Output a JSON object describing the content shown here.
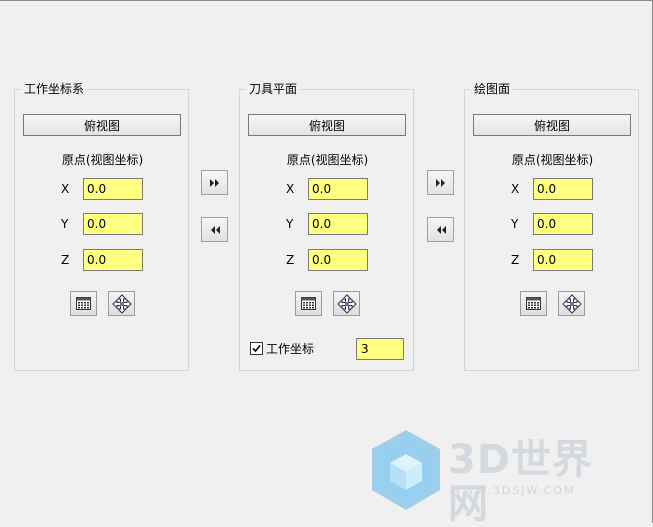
{
  "panels": [
    {
      "title": "工作坐标系",
      "view_button": "俯视图",
      "origin_label": "原点(视图坐标)",
      "axes": [
        {
          "label": "X",
          "value": "0.0"
        },
        {
          "label": "Y",
          "value": "0.0"
        },
        {
          "label": "Z",
          "value": "0.0"
        }
      ]
    },
    {
      "title": "刀具平面",
      "view_button": "俯视图",
      "origin_label": "原点(视图坐标)",
      "axes": [
        {
          "label": "X",
          "value": "0.0"
        },
        {
          "label": "Y",
          "value": "0.0"
        },
        {
          "label": "Z",
          "value": "0.0"
        }
      ],
      "work_coord": {
        "label": "工作坐标",
        "checked": true,
        "value": "3"
      }
    },
    {
      "title": "绘图面",
      "view_button": "俯视图",
      "origin_label": "原点(视图坐标)",
      "axes": [
        {
          "label": "X",
          "value": "0.0"
        },
        {
          "label": "Y",
          "value": "0.0"
        },
        {
          "label": "Z",
          "value": "0.0"
        }
      ]
    }
  ],
  "icons": {
    "copy_right": "double-right-arrow-icon",
    "copy_left": "double-left-arrow-icon",
    "origin_select": "calculator-grid-icon",
    "origin_move": "move-cross-icon"
  },
  "watermark": {
    "brand": "3D世界网",
    "url": "WWW.3DSJW.COM"
  },
  "colors": {
    "input_bg": "#ffff80",
    "window_bg": "#f0f0f0",
    "watermark_blue": "#5ab4e8"
  }
}
